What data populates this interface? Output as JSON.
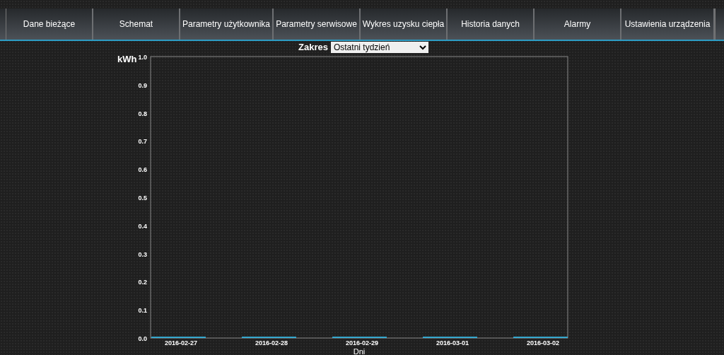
{
  "nav": {
    "tabs": [
      {
        "label": "Dane bieżące",
        "selected": false
      },
      {
        "label": "Schemat",
        "selected": false
      },
      {
        "label": "Parametry użytkownika",
        "selected": false
      },
      {
        "label": "Parametry serwisowe",
        "selected": false
      },
      {
        "label": "Wykres uzysku ciepła",
        "selected": false
      },
      {
        "label": "Historia danych",
        "selected": false
      },
      {
        "label": "Alarmy",
        "selected": false
      },
      {
        "label": "Ustawienia urządzenia",
        "selected": false
      }
    ]
  },
  "range": {
    "label": "Zakres",
    "value": "Ostatni tydzień"
  },
  "chart": {
    "chart_data": {
      "type": "bar",
      "ylabel": "kWh",
      "xlabel": "Dni",
      "categories": [
        "2016-02-27",
        "2016-02-28",
        "2016-02-29",
        "2016-03-01",
        "2016-03-02"
      ],
      "series": [
        {
          "color": "#35a8cf",
          "values": [
            0,
            0,
            0,
            0,
            0
          ]
        }
      ],
      "ylim": [
        0,
        1
      ],
      "yticks": [
        {
          "value": 0,
          "label": "0.0"
        },
        {
          "value": 0.1,
          "label": "0.1"
        },
        {
          "value": 0.2,
          "label": "0.2"
        },
        {
          "value": 0.3,
          "label": "0.3"
        },
        {
          "value": 0.4,
          "label": "0.4"
        },
        {
          "value": 0.5,
          "label": "0.5"
        },
        {
          "value": 0.6,
          "label": "0.6"
        },
        {
          "value": 0.7,
          "label": "0.7"
        },
        {
          "value": 0.8,
          "label": "0.8"
        },
        {
          "value": 0.9,
          "label": "0.9"
        },
        {
          "value": 1,
          "label": "1.0"
        }
      ]
    }
  }
}
